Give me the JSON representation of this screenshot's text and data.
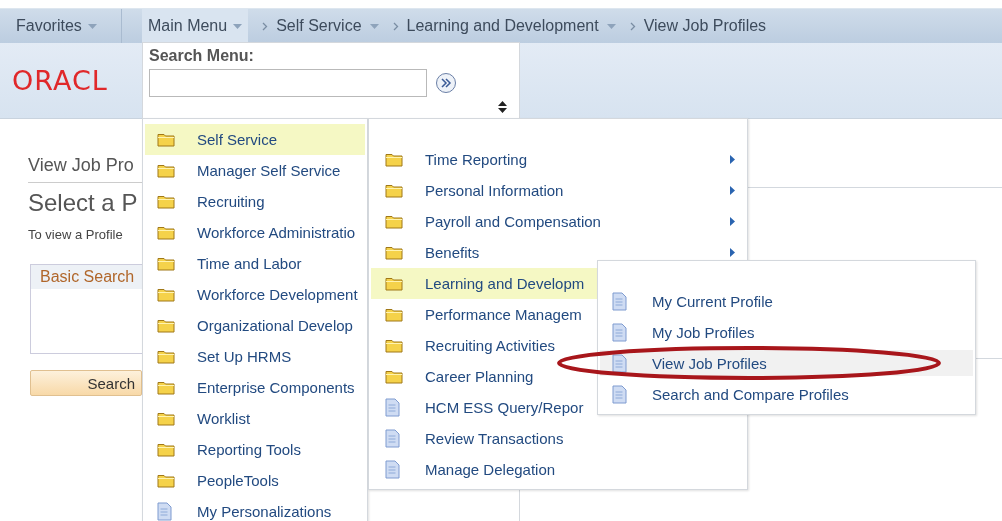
{
  "nav": {
    "favorites": "Favorites",
    "main_menu": "Main Menu",
    "breadcrumbs": [
      {
        "label": "Self Service",
        "dropdown": true
      },
      {
        "label": "Learning and Development",
        "dropdown": true
      },
      {
        "label": "View Job Profiles",
        "dropdown": false
      }
    ]
  },
  "logo": "ORACL",
  "page": {
    "title": "View Job Pro",
    "heading": "Select a P",
    "instruction": "To view a Profile",
    "search_tab": "Basic Search",
    "search_button": "Search"
  },
  "main_menu": {
    "search_label": "Search Menu:",
    "items": [
      {
        "label": "Self Service",
        "kind": "folder",
        "selected": true
      },
      {
        "label": "Manager Self Service",
        "kind": "folder",
        "selected": false
      },
      {
        "label": "Recruiting",
        "kind": "folder",
        "selected": false
      },
      {
        "label": "Workforce Administratio",
        "kind": "folder",
        "selected": false
      },
      {
        "label": "Time and Labor",
        "kind": "folder",
        "selected": false
      },
      {
        "label": "Workforce Development",
        "kind": "folder",
        "selected": false
      },
      {
        "label": "Organizational Develop",
        "kind": "folder",
        "selected": false
      },
      {
        "label": "Set Up HRMS",
        "kind": "folder",
        "selected": false
      },
      {
        "label": "Enterprise Components",
        "kind": "folder",
        "selected": false
      },
      {
        "label": "Worklist",
        "kind": "folder",
        "selected": false
      },
      {
        "label": "Reporting Tools",
        "kind": "folder",
        "selected": false
      },
      {
        "label": "PeopleTools",
        "kind": "folder",
        "selected": false
      },
      {
        "label": "My Personalizations",
        "kind": "page",
        "selected": false
      }
    ]
  },
  "submenu": {
    "items": [
      {
        "label": "Time Reporting",
        "kind": "folder",
        "has_submenu": true,
        "selected": false
      },
      {
        "label": "Personal Information",
        "kind": "folder",
        "has_submenu": true,
        "selected": false
      },
      {
        "label": "Payroll and Compensation",
        "kind": "folder",
        "has_submenu": true,
        "selected": false
      },
      {
        "label": "Benefits",
        "kind": "folder",
        "has_submenu": true,
        "selected": false
      },
      {
        "label": "Learning and Developm",
        "kind": "folder",
        "has_submenu": false,
        "selected": true
      },
      {
        "label": "Performance Managem",
        "kind": "folder",
        "has_submenu": false,
        "selected": false
      },
      {
        "label": "Recruiting Activities",
        "kind": "folder",
        "has_submenu": false,
        "selected": false
      },
      {
        "label": "Career Planning",
        "kind": "folder",
        "has_submenu": false,
        "selected": false
      },
      {
        "label": "HCM ESS Query/Repor",
        "kind": "page",
        "has_submenu": false,
        "selected": false
      },
      {
        "label": "Review Transactions",
        "kind": "page",
        "has_submenu": false,
        "selected": false
      },
      {
        "label": "Manage Delegation",
        "kind": "page",
        "has_submenu": false,
        "selected": false
      }
    ]
  },
  "submenu_2": {
    "items": [
      {
        "label": "My Current Profile",
        "kind": "page",
        "selected": false
      },
      {
        "label": "My Job Profiles",
        "kind": "page",
        "selected": false
      },
      {
        "label": "View Job Profiles",
        "kind": "page",
        "selected": true
      },
      {
        "label": "Search and Compare Profiles",
        "kind": "page",
        "selected": false
      }
    ]
  }
}
